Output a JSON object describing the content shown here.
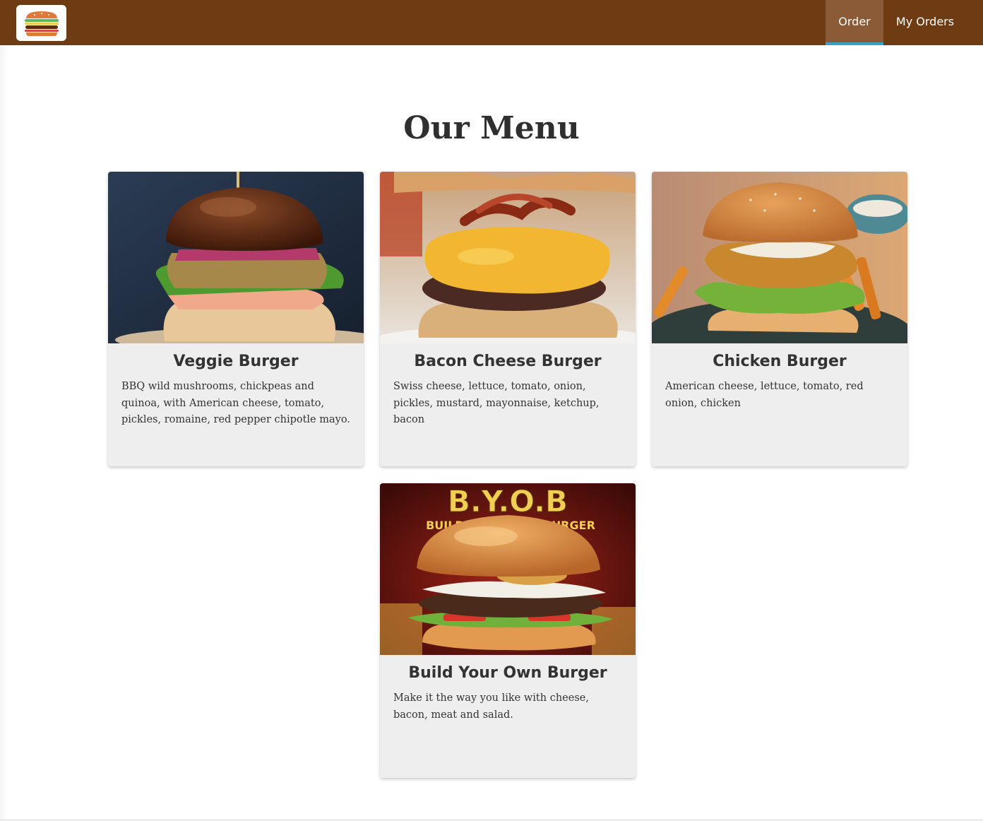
{
  "header": {
    "logo_icon": "burger-icon",
    "nav": {
      "order_label": "Order",
      "my_orders_label": "My Orders"
    },
    "colors": {
      "background": "#6e3b12",
      "active_tab": "#8b5a36",
      "active_underline": "#3aa0c4"
    }
  },
  "main": {
    "title": "Our Menu",
    "cards": [
      {
        "title": "Veggie Burger",
        "description": "BBQ wild mushrooms, chickpeas and quinoa, with American cheese, tomato, pickles, romaine, red pepper chipotle mayo."
      },
      {
        "title": "Bacon Cheese Burger",
        "description": "Swiss cheese, lettuce, tomato, onion, pickles, mustard, mayonnaise, ketchup, bacon"
      },
      {
        "title": "Chicken Burger",
        "description": "American cheese, lettuce, tomato, red onion, chicken"
      },
      {
        "title": "Build Your Own Burger",
        "description": "Make it the way you like with cheese, bacon, meat and salad.",
        "image_text": {
          "headline": "B.Y.O.B",
          "subline": "BUILD YOUR OWN BURGER"
        }
      }
    ]
  }
}
